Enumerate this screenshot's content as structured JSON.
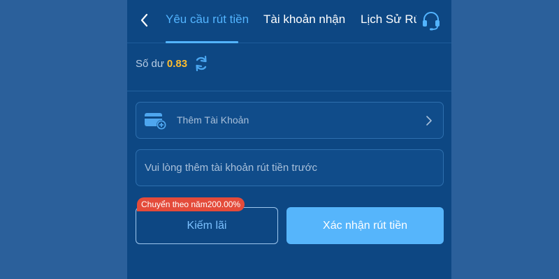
{
  "header": {
    "tabs": [
      {
        "label": "Yêu cầu rút tiền",
        "active": true
      },
      {
        "label": "Tài khoản nhận",
        "active": false
      },
      {
        "label": "Lịch Sử Rút",
        "active": false
      }
    ],
    "icons": {
      "back": "chevron-left-icon",
      "support": "headset-icon"
    }
  },
  "balance": {
    "label": "Số dư",
    "value": "0.83",
    "refresh_icon": "refresh-icon"
  },
  "add_account": {
    "label": "Thêm Tài Khoản",
    "icon": "card-add-icon",
    "chevron_icon": "chevron-right-icon"
  },
  "withdraw_account_input": {
    "value": "",
    "placeholder": "Vui lòng thêm tài khoản rút tiền trước"
  },
  "interest_badge": "Chuyển theo năm200.00%",
  "buttons": {
    "interest": "Kiếm lãi",
    "confirm": "Xác nhận rút tiền"
  },
  "colors": {
    "page_background": "#2b609b",
    "panel_background": "#0d4783",
    "accent": "#53b4ff",
    "balance_value": "#ffbd2e",
    "badge": "#e44b3a",
    "confirm_button": "#56b5fb"
  }
}
